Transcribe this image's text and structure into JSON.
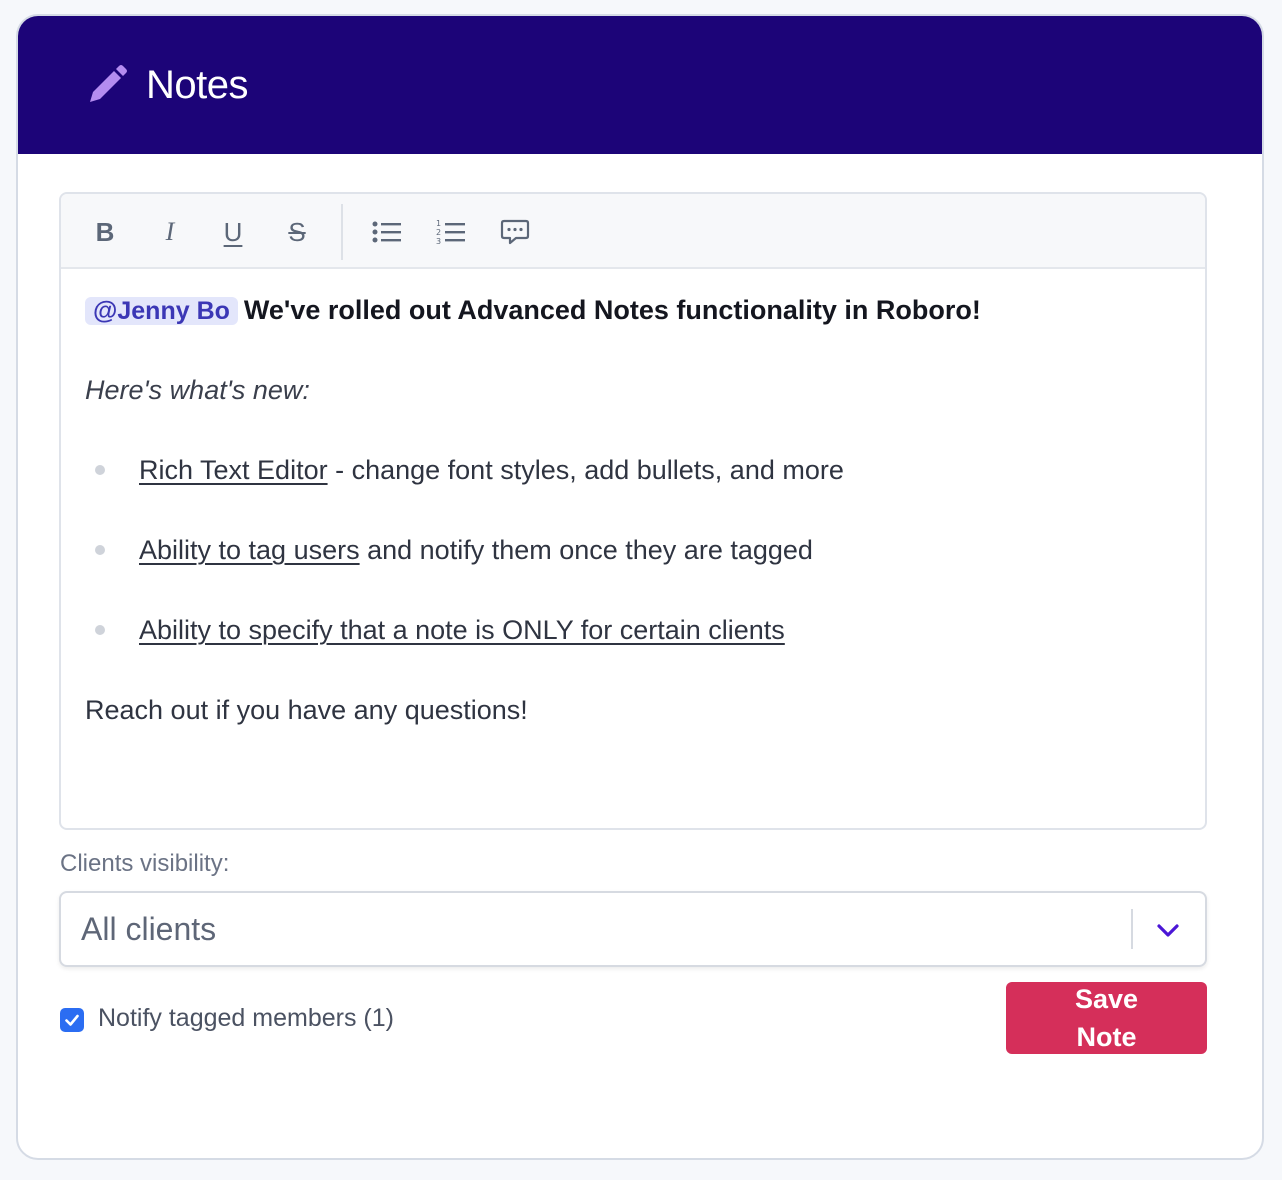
{
  "header": {
    "title": "Notes",
    "icon": "pencil-icon"
  },
  "toolbar": {
    "bold": "B",
    "italic": "I",
    "underline": "U",
    "strike": "S",
    "icons": [
      "bulleted-list-icon",
      "numbered-list-icon",
      "comment-icon"
    ]
  },
  "content": {
    "mention": "@Jenny Bo",
    "headline": "We've rolled out Advanced Notes functionality in Roboro!",
    "subhead": "Here's what's new:",
    "bullets": [
      {
        "link": "Rich Text Editor",
        "rest": " - change font styles, add bullets, and more"
      },
      {
        "link": "Ability to tag users",
        "rest": " and notify them once they are tagged"
      },
      {
        "link": "Ability to specify that a note is ONLY for certain clients",
        "rest": ""
      }
    ],
    "closing": "Reach out if you have any questions!"
  },
  "visibility": {
    "label": "Clients visibility:",
    "selected": "All clients"
  },
  "notify": {
    "label": "Notify tagged members (1)",
    "checked": true
  },
  "save": {
    "label_line1": "Save",
    "label_line2": "Note"
  },
  "colors": {
    "header_bg": "#1c0478",
    "accent_pencil": "#b48cf0",
    "mention_bg": "#e3e6fb",
    "mention_text": "#3b37b5",
    "save_bg": "#d52f5a",
    "checkbox": "#2b6df2",
    "chevron": "#4b16d6"
  }
}
